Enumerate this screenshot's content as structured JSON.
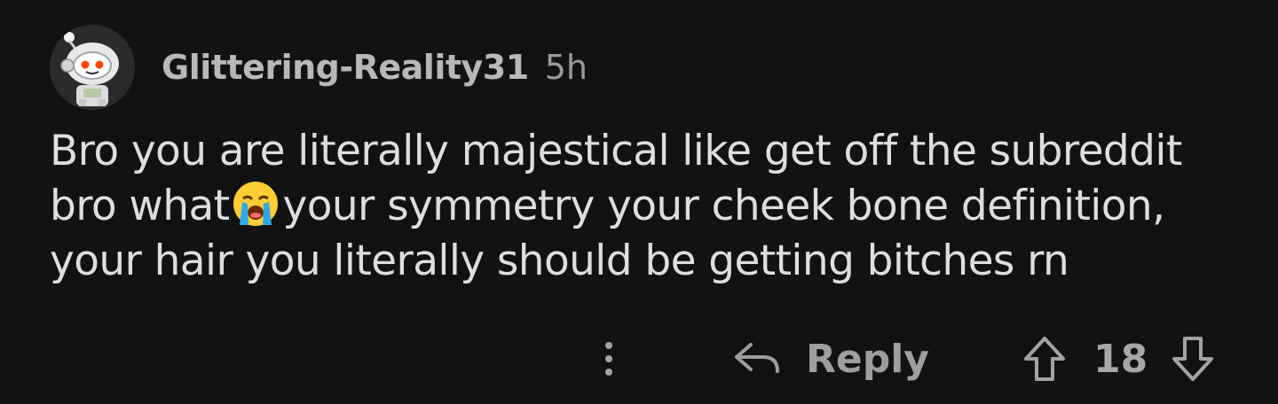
{
  "comment": {
    "author": "Glittering-Reality31",
    "timestamp": "5h",
    "body_lines": [
      "Bro you are literally majestical like get off the subreddit",
      "bro what",
      "your symmetry your cheek bone definition,",
      "your hair you literally should be getting bitches rn"
    ],
    "emoji": "loudly-crying-face"
  },
  "actions": {
    "reply_label": "Reply",
    "score": "18"
  },
  "colors": {
    "background": "#121212",
    "text": "#dedede",
    "muted": "#9e9e9e"
  }
}
